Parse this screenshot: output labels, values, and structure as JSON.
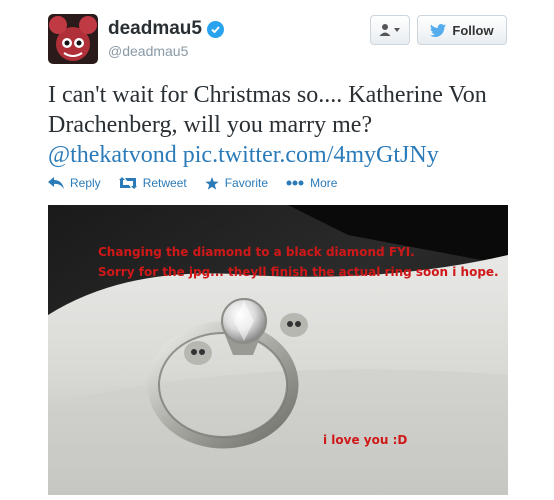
{
  "user": {
    "display_name": "deadmau5",
    "handle": "@deadmau5",
    "verified": true,
    "avatar_icon": "mau5head-avatar"
  },
  "buttons": {
    "user_menu_icon": "person-dropdown-icon",
    "follow_label": "Follow",
    "follow_icon": "twitter-bird-icon"
  },
  "tweet": {
    "text": "I can't wait for Christmas so.... Katherine Von Drachenberg, will you marry me?",
    "mention": "@thekatvond",
    "link": "pic.twitter.com/4myGtJNy"
  },
  "actions": [
    {
      "label": "Reply",
      "icon": "reply-arrow-icon"
    },
    {
      "label": "Retweet",
      "icon": "retweet-icon"
    },
    {
      "label": "Favorite",
      "icon": "star-icon"
    },
    {
      "label": "More",
      "icon": "dots-icon"
    }
  ],
  "media": {
    "caption_line1": "Changing the diamond to a black diamond FYI.",
    "caption_line2": "Sorry for the jpg... theyll finish the actual ring soon i hope.",
    "caption_love": "i love you :D",
    "caption_color": "#d01818"
  },
  "colors": {
    "link": "#2b7bb9",
    "verified": "#2aa3ef",
    "handle": "#8899a6"
  }
}
